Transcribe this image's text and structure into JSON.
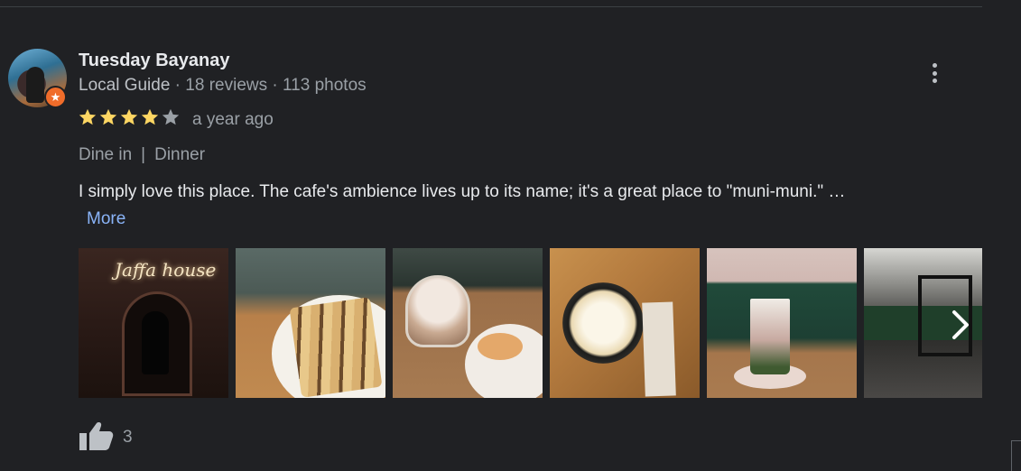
{
  "reviewer": {
    "name": "Tuesday Bayanay",
    "level": "Local Guide",
    "reviews": "18 reviews",
    "photos_count": "113 photos",
    "separator": " · "
  },
  "review": {
    "rating": 4,
    "max_rating": 5,
    "time": "a year ago",
    "tags": [
      "Dine in",
      "Dinner"
    ],
    "tag_separator": "|",
    "text": "I simply love this place. The cafe's ambience lives up to its name; it's a great place to \"muni-muni.\" …",
    "more_label": "More"
  },
  "photos": [
    {
      "name": "photo-neon-sign-mirror",
      "neon_text": "Jaffa house"
    },
    {
      "name": "photo-sandwich-plate"
    },
    {
      "name": "photo-latte-and-chips"
    },
    {
      "name": "photo-coffee-cup-top"
    },
    {
      "name": "photo-iced-drink"
    },
    {
      "name": "photo-interior"
    }
  ],
  "reactions": {
    "likes": "3"
  },
  "colors": {
    "background": "#202124",
    "star_filled": "#fdd663",
    "star_empty": "#9aa0a6",
    "link": "#8ab4f8",
    "local_guide_badge": "#f06c2a"
  },
  "icons": {
    "menu": "more-vert-icon",
    "next": "chevron-right-icon",
    "like": "thumb-up-icon",
    "badge": "local-guide-star-icon"
  }
}
